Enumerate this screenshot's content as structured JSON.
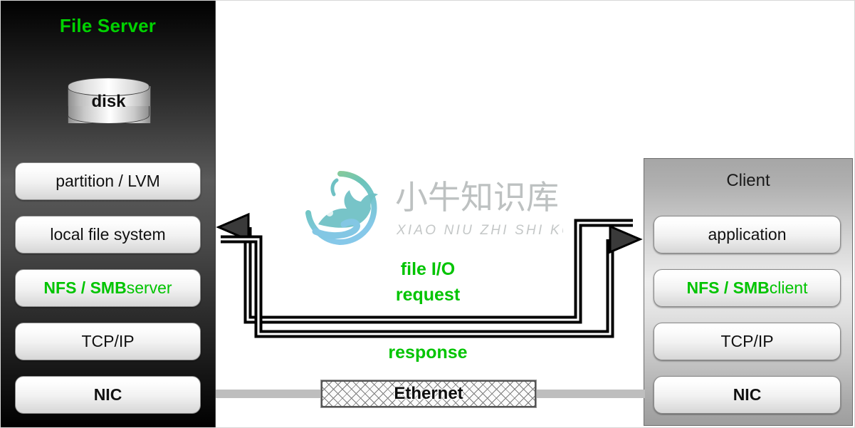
{
  "server": {
    "title": "File Server",
    "disk": {
      "label": "disk"
    },
    "layers": [
      {
        "id": "partition",
        "label": "partition / LVM",
        "style": "plain"
      },
      {
        "id": "localfs",
        "label": "local file system",
        "style": "plain"
      },
      {
        "id": "nfs-server",
        "label_bold": "NFS / SMB",
        "label_rest": " server",
        "style": "green"
      },
      {
        "id": "tcpip",
        "label": "TCP/IP",
        "style": "plain"
      },
      {
        "id": "nic",
        "label": "NIC",
        "style": "bold"
      }
    ]
  },
  "client": {
    "title": "Client",
    "layers": [
      {
        "id": "application",
        "label": "application",
        "style": "plain"
      },
      {
        "id": "nfs-client",
        "label_bold": "NFS / SMB",
        "label_rest": " client",
        "style": "green"
      },
      {
        "id": "tcpip",
        "label": "TCP/IP",
        "style": "plain"
      },
      {
        "id": "nic",
        "label": "NIC",
        "style": "bold"
      }
    ]
  },
  "network": {
    "ethernet_label": "Ethernet"
  },
  "flows": {
    "request_line1": "file I/O",
    "request_line2": "request",
    "response": "response"
  },
  "watermark": {
    "cn_text": "小牛知识库",
    "pinyin_text": "XIAO NIU ZHI SHI KU",
    "logo_name": "ox-in-circle-logo"
  },
  "colors": {
    "accent_green": "#00c400",
    "title_green": "#00d200",
    "server_bg_dark": "#000000",
    "client_bg_gray": "#b0b0b0",
    "box_text": "#111111",
    "cable_gray": "#bebebe",
    "arrow_stroke": "#000000"
  }
}
